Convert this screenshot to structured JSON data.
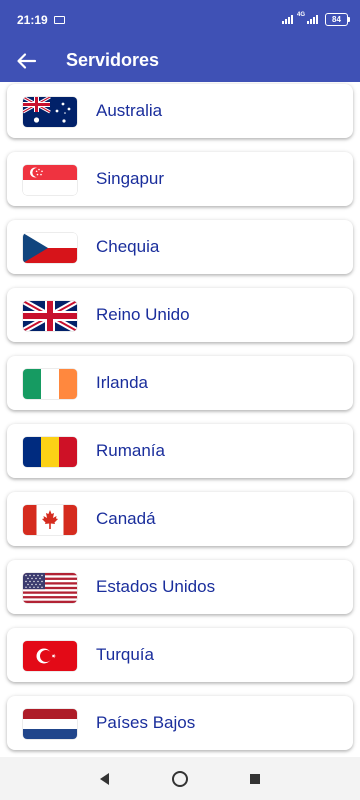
{
  "status_bar": {
    "time": "21:19",
    "network": "4G",
    "battery": "84"
  },
  "toolbar": {
    "back_icon": "arrow-left-icon",
    "title": "Servidores"
  },
  "colors": {
    "primary": "#3f51b5",
    "text": "#1a2e9c"
  },
  "servers": [
    {
      "name": "Australia",
      "flag": "au"
    },
    {
      "name": "Singapur",
      "flag": "sg"
    },
    {
      "name": "Chequia",
      "flag": "cz"
    },
    {
      "name": "Reino Unido",
      "flag": "gb"
    },
    {
      "name": "Irlanda",
      "flag": "ie"
    },
    {
      "name": "Rumanía",
      "flag": "ro"
    },
    {
      "name": "Canadá",
      "flag": "ca"
    },
    {
      "name": "Estados Unidos",
      "flag": "us"
    },
    {
      "name": "Turquía",
      "flag": "tr"
    },
    {
      "name": "Países Bajos",
      "flag": "nl"
    }
  ],
  "nav_bar": {
    "back": "back-triangle-icon",
    "home": "home-circle-icon",
    "recents": "recents-square-icon"
  }
}
